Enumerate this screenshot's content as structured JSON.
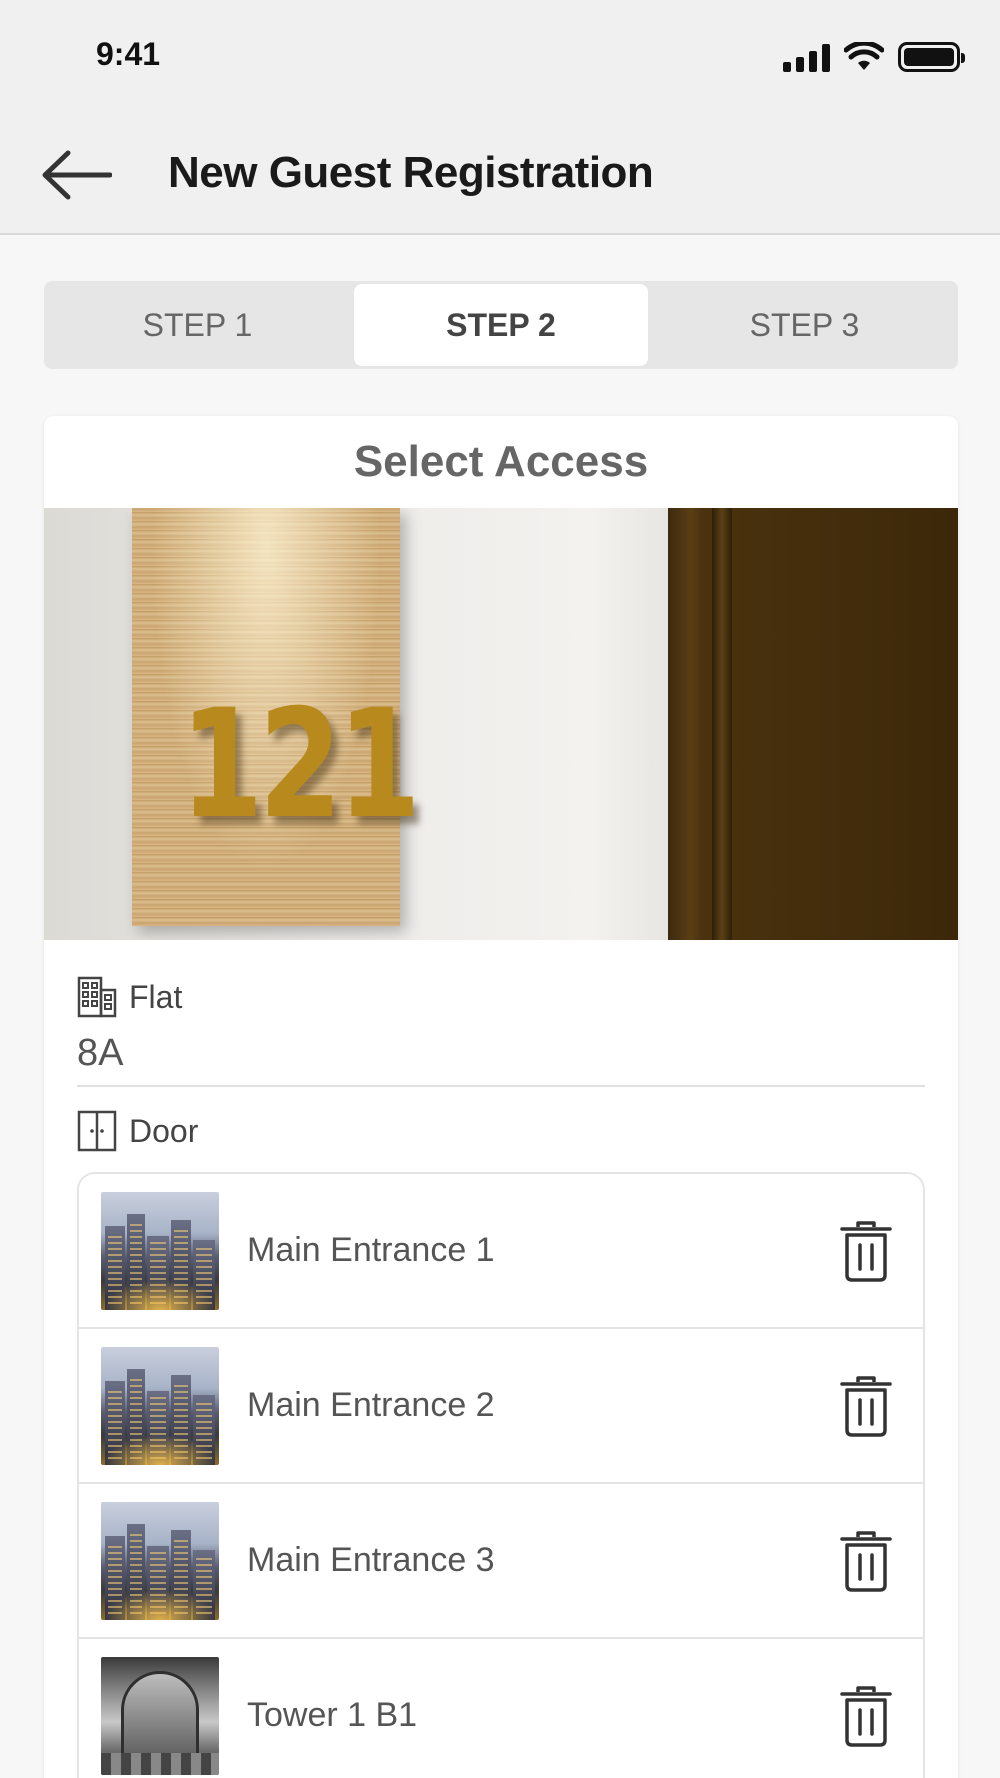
{
  "status_bar": {
    "time": "9:41"
  },
  "header": {
    "title": "New Guest Registration",
    "back_icon": "arrow-left-icon"
  },
  "stepper": {
    "steps": [
      {
        "label": "STEP 1",
        "active": false
      },
      {
        "label": "STEP 2",
        "active": true
      },
      {
        "label": "STEP 3",
        "active": false
      }
    ]
  },
  "card": {
    "title": "Select Access",
    "photo_sign_text": "121",
    "flat": {
      "label": "Flat",
      "icon": "building-icon",
      "value": "8A"
    },
    "door": {
      "label": "Door",
      "icon": "door-icon",
      "items": [
        {
          "name": "Main Entrance 1",
          "thumb": "city-skyline",
          "action_icon": "trash-icon"
        },
        {
          "name": "Main Entrance 2",
          "thumb": "city-skyline",
          "action_icon": "trash-icon"
        },
        {
          "name": "Main Entrance 3",
          "thumb": "city-skyline",
          "action_icon": "trash-icon"
        },
        {
          "name": "Tower 1 B1",
          "thumb": "lobby",
          "action_icon": "trash-icon"
        }
      ]
    }
  },
  "colors": {
    "header_bg": "#f0f0f0",
    "page_bg": "#f7f7f7",
    "stepper_bg": "#e6e6e6",
    "active_step_bg": "#ffffff",
    "text_dark": "#1a1a1a",
    "text_muted": "#666666"
  }
}
